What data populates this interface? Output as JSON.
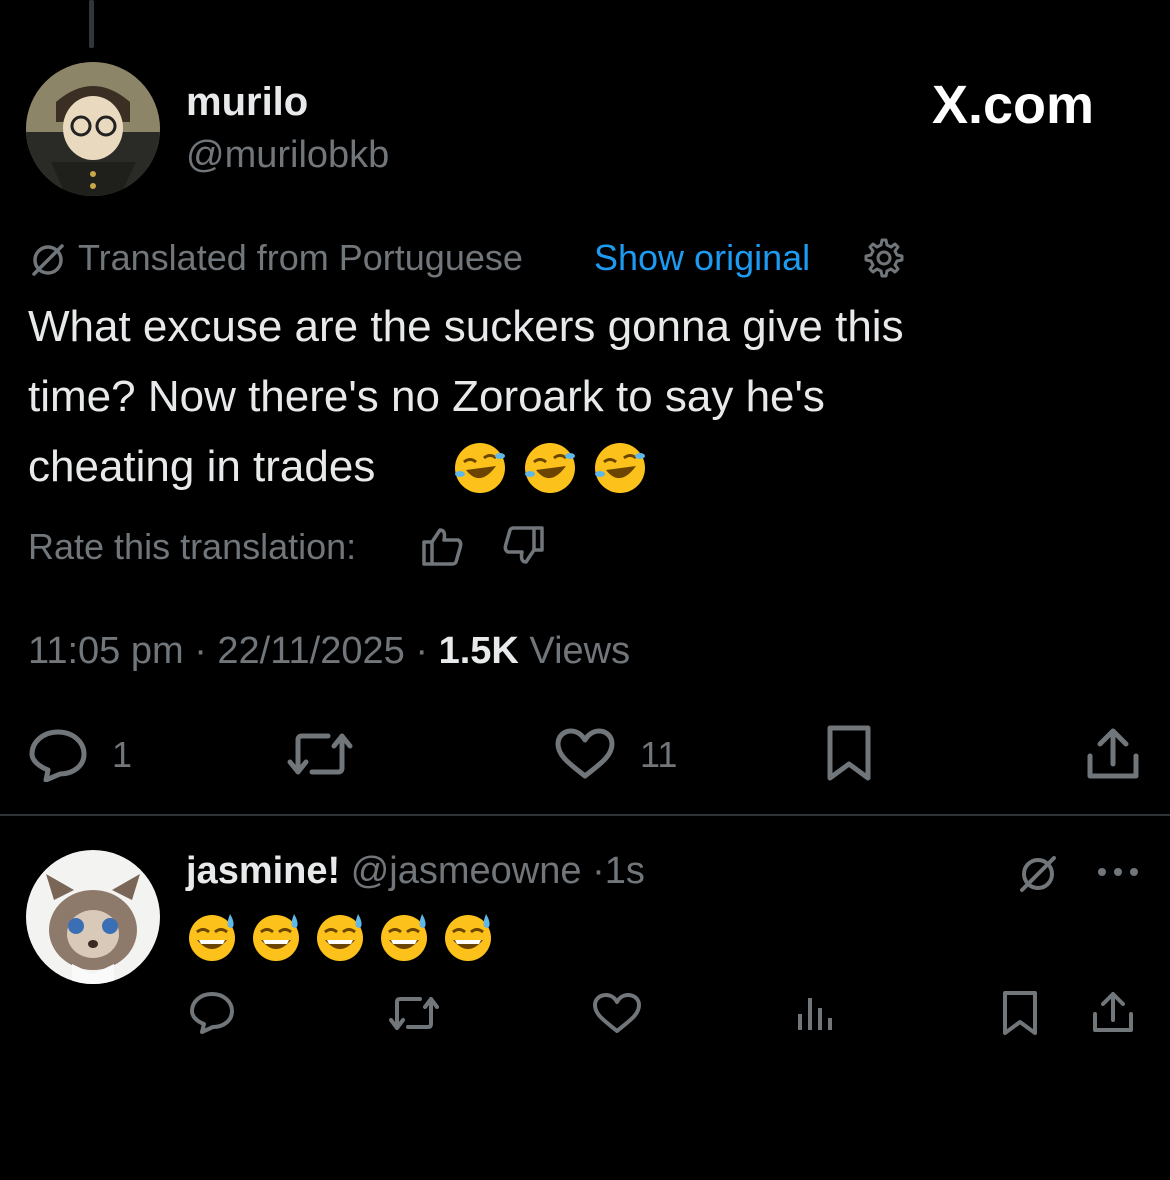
{
  "main_tweet": {
    "author_name": "murilo",
    "author_handle": "@murilobkb",
    "brand": "X.com",
    "translated_label": "Translated from Portuguese",
    "show_original": "Show original",
    "text_line1": "What excuse are the suckers gonna give this",
    "text_line2": "time? Now there's no Zoroark to say he's",
    "text_line3": "cheating in trades",
    "text_emoji": "🤣🤣🤣",
    "rate_label": "Rate this translation:",
    "time": "11:05 pm",
    "date": "22/11/2025",
    "views_count": "1.5K",
    "views_label": "Views",
    "replies": "1",
    "likes": "11"
  },
  "reply": {
    "author_name": "jasmine!",
    "author_handle": "@jasmeowne",
    "age": "1s",
    "text_emoji": "😅😅😅😅😅"
  },
  "colors": {
    "background": "#000000",
    "text": "#e7e9ea",
    "muted": "#71767b",
    "link": "#1d9bf0"
  }
}
